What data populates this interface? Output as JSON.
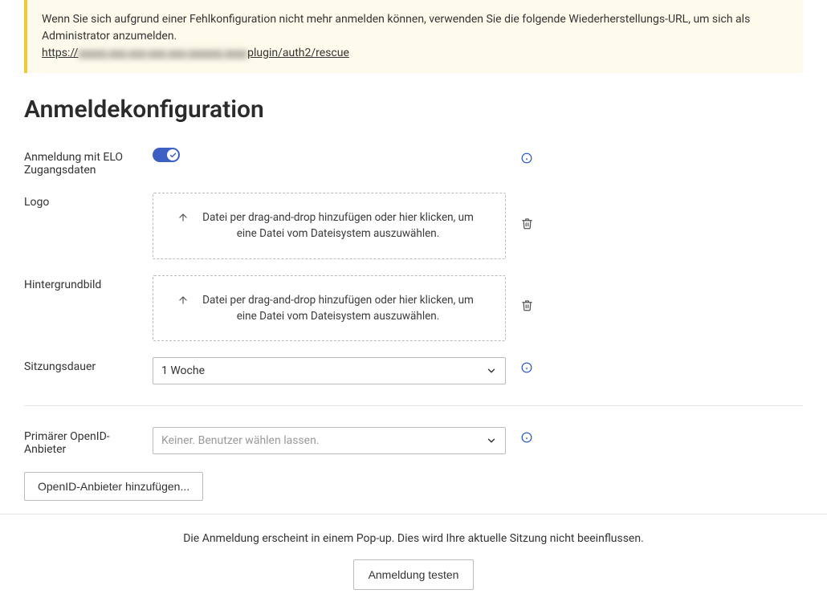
{
  "notice": {
    "text": "Wenn Sie sich aufgrund einer Fehlkonfiguration nicht mehr anmelden können, verwenden Sie die folgende Wiederherstellungs-URL, um sich als Administrator anzumelden.",
    "url_prefix": "https://",
    "url_hidden": "xxxxx-xxx-xxx-xxx-xxx-xxxxxx-xxxx",
    "url_suffix": "plugin/auth2/rescue"
  },
  "page_title": "Anmeldekonfiguration",
  "fields": {
    "elo_login": {
      "label": "Anmeldung mit ELO Zugangsdaten",
      "enabled": true
    },
    "logo": {
      "label": "Logo",
      "dropzone_text": "Datei per drag-and-drop hinzufügen oder hier klicken, um eine Datei vom Dateisystem auszuwählen."
    },
    "background": {
      "label": "Hintergrundbild",
      "dropzone_text": "Datei per drag-and-drop hinzufügen oder hier klicken, um eine Datei vom Dateisystem auszuwählen."
    },
    "session_duration": {
      "label": "Sitzungsdauer",
      "value": "1 Woche"
    },
    "primary_openid": {
      "label": "Primärer OpenID-Anbieter",
      "placeholder": "Keiner. Benutzer wählen lassen."
    }
  },
  "add_openid_button": "OpenID-Anbieter hinzufügen...",
  "footer": {
    "text": "Die Anmeldung erscheint in einem Pop-up. Dies wird Ihre aktuelle Sitzung nicht beeinflussen.",
    "test_button": "Anmeldung testen"
  }
}
